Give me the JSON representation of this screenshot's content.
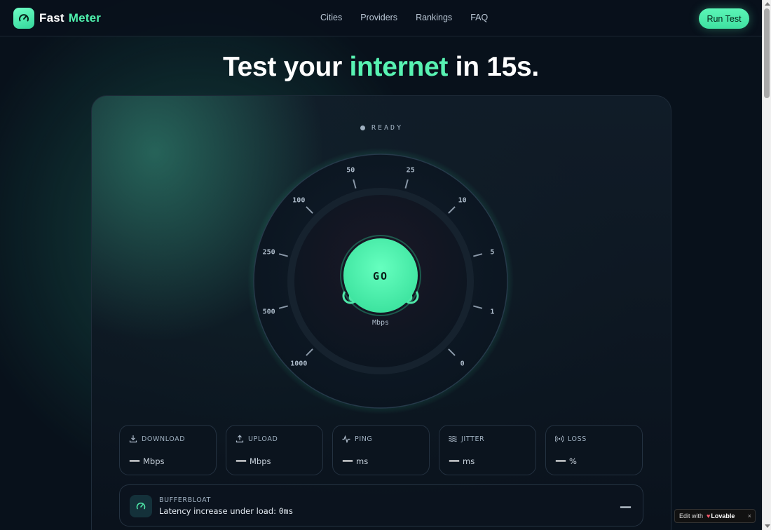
{
  "nav": {
    "logo_word1": "Fast",
    "logo_word2": "Meter",
    "links": [
      "Cities",
      "Providers",
      "Rankings",
      "FAQ"
    ],
    "cta": "Run Test"
  },
  "headline": {
    "part1": "Test your",
    "accent": "internet",
    "part2": "in 15s."
  },
  "status": "READY",
  "gauge": {
    "ticks": [
      "0",
      "1",
      "5",
      "10",
      "25",
      "50",
      "100",
      "250",
      "500",
      "1000"
    ],
    "button_label": "GO",
    "unit": "Mbps"
  },
  "stats": [
    {
      "label": "DOWNLOAD",
      "value": "—",
      "unit": "Mbps",
      "icon": "download-icon"
    },
    {
      "label": "UPLOAD",
      "value": "—",
      "unit": "Mbps",
      "icon": "upload-icon"
    },
    {
      "label": "PING",
      "value": "—",
      "unit": "ms",
      "icon": "activity-icon"
    },
    {
      "label": "JITTER",
      "value": "—",
      "unit": "ms",
      "icon": "wave-icon"
    },
    {
      "label": "LOSS",
      "value": "—",
      "unit": "%",
      "icon": "signal-icon"
    }
  ],
  "bufferbloat": {
    "title": "BUFFERBLOAT",
    "subtitle": "Latency increase under load: ",
    "value": "0ms",
    "result": "—"
  },
  "edit_badge": {
    "prefix": "Edit with",
    "brand": "Lovable",
    "close": "×"
  },
  "colors": {
    "accent": "#58f2b2",
    "background": "#08111b"
  }
}
